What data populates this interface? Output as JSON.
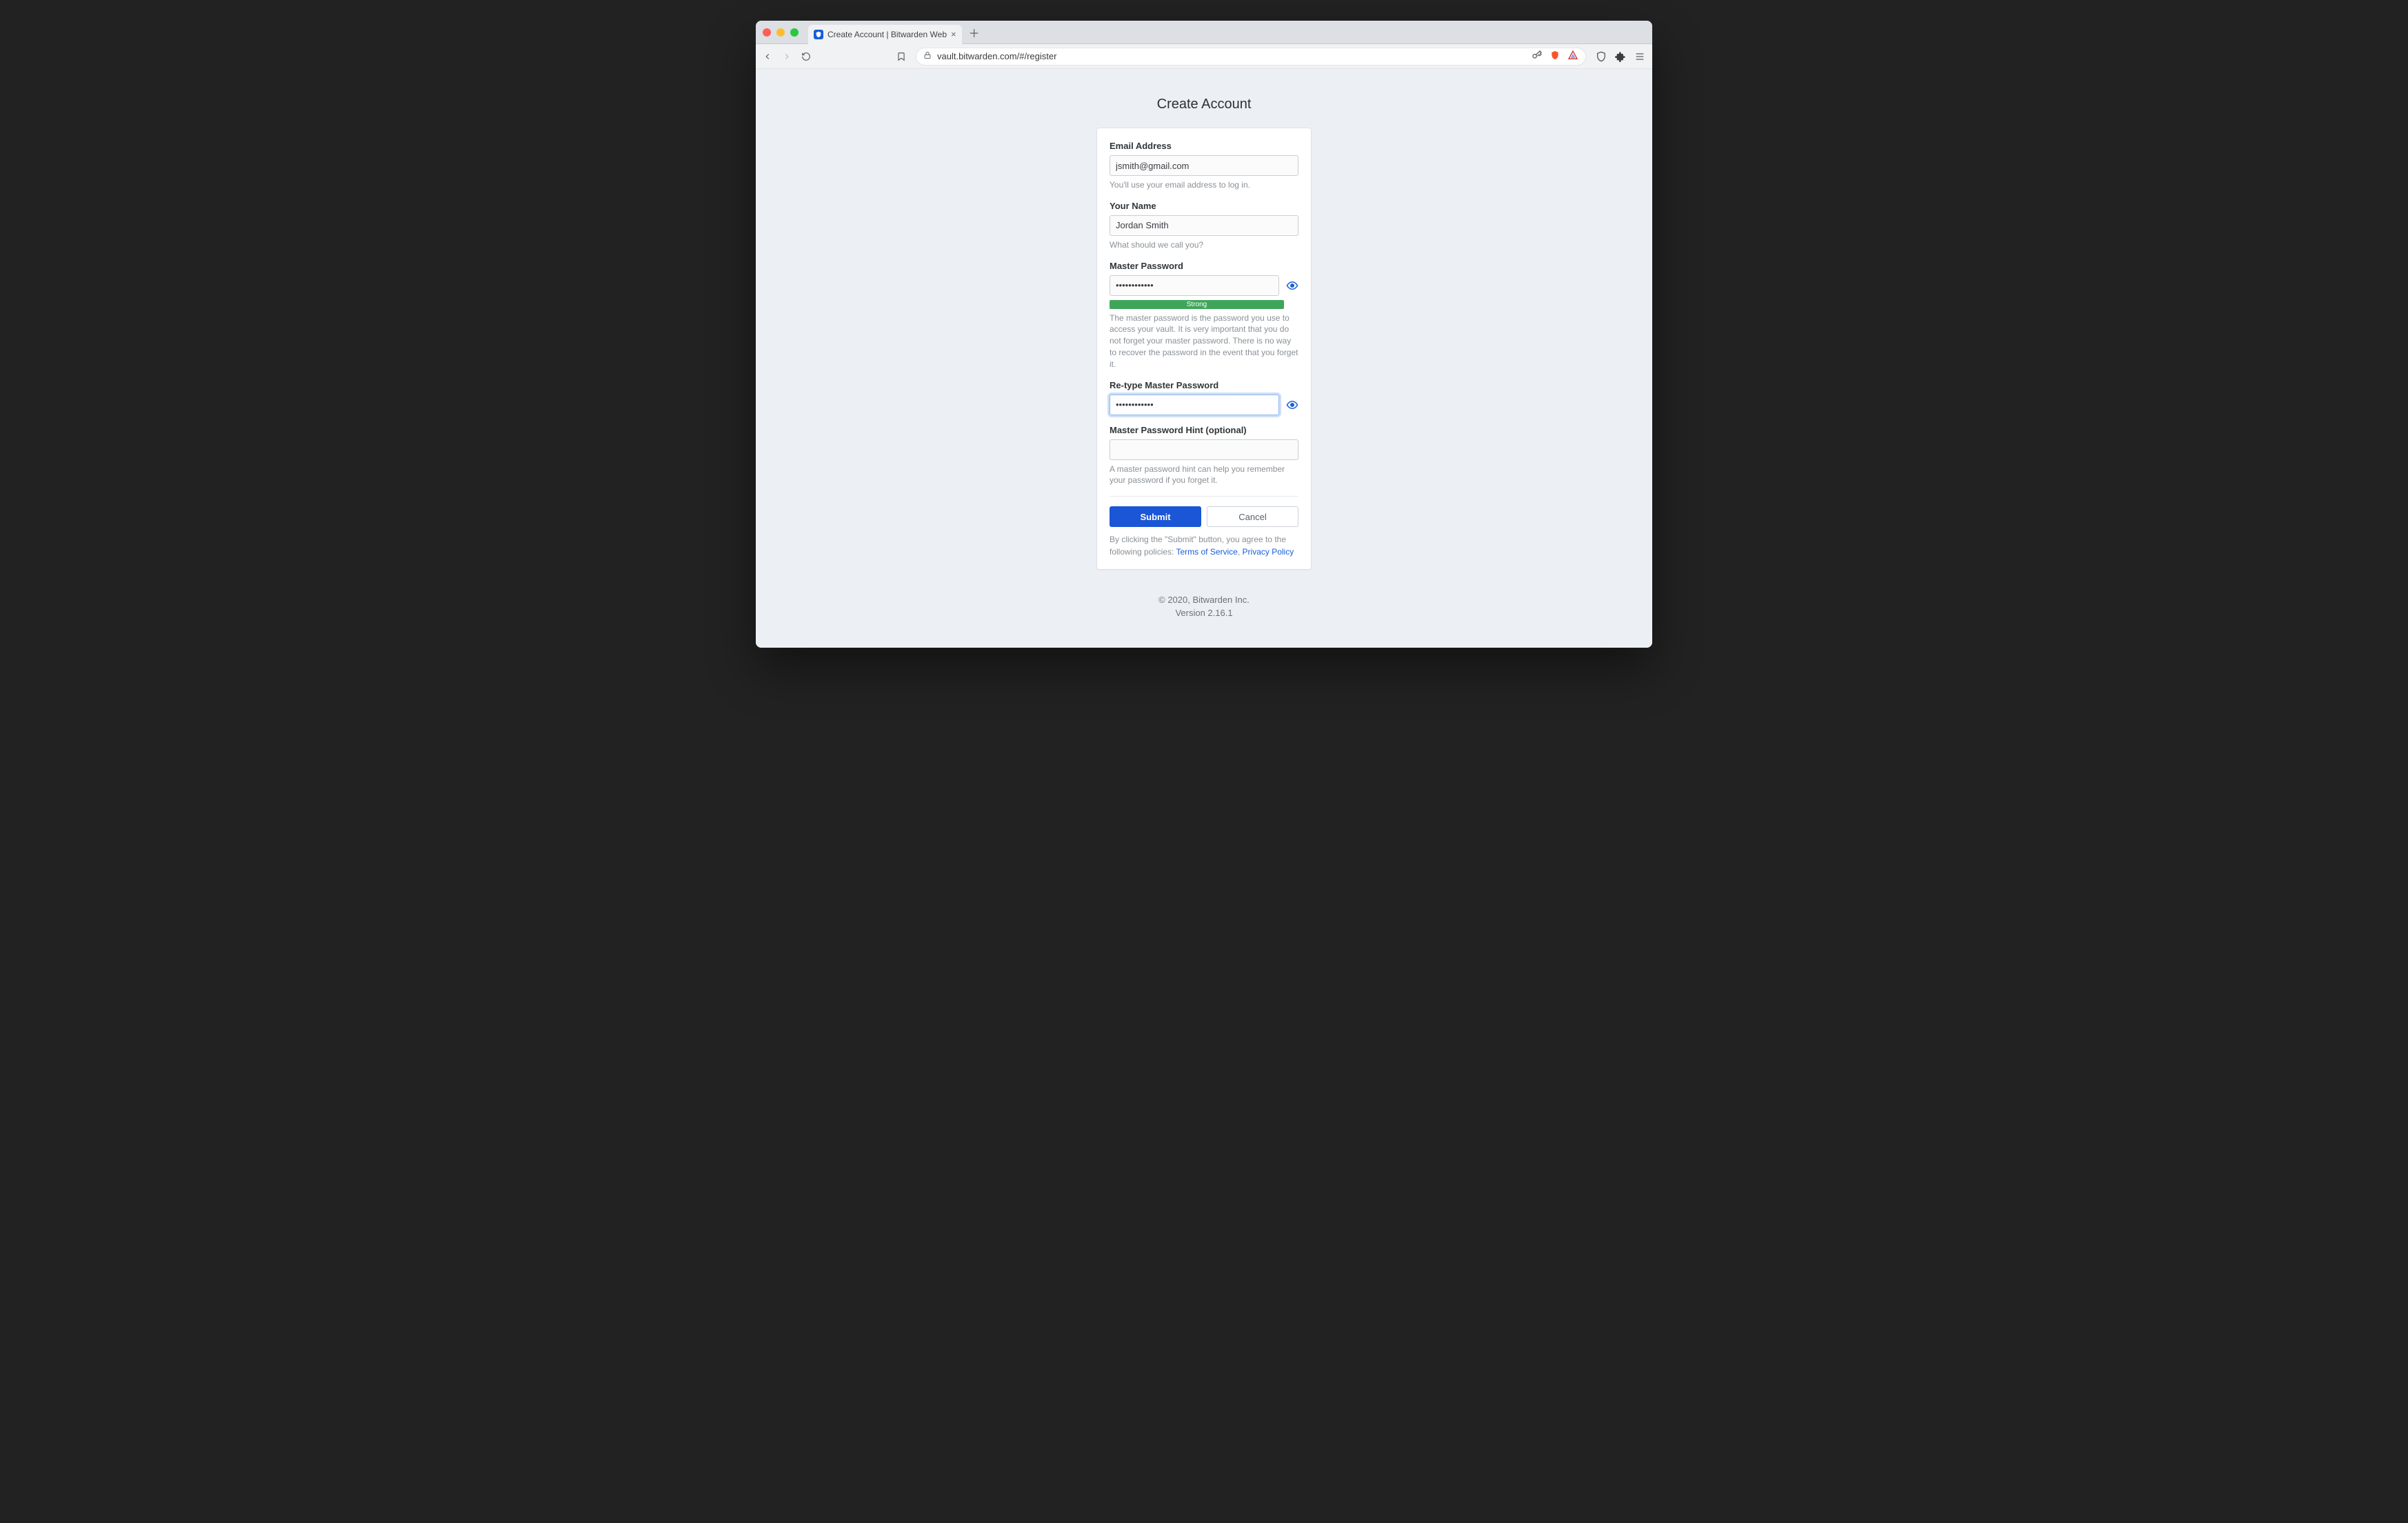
{
  "browser": {
    "tab_title": "Create Account | Bitwarden Web",
    "url": "vault.bitwarden.com/#/register"
  },
  "page": {
    "title": "Create Account"
  },
  "form": {
    "email": {
      "label": "Email Address",
      "value": "jsmith@gmail.com",
      "hint": "You'll use your email address to log in."
    },
    "name": {
      "label": "Your Name",
      "value": "Jordan Smith",
      "hint": "What should we call you?"
    },
    "master_password": {
      "label": "Master Password",
      "value": "••••••••••••",
      "strength": "Strong",
      "hint": "The master password is the password you use to access your vault. It is very important that you do not forget your master password. There is no way to recover the password in the event that you forget it."
    },
    "retype_password": {
      "label": "Re-type Master Password",
      "value": "••••••••••••"
    },
    "hint_field": {
      "label": "Master Password Hint (optional)",
      "value": "",
      "hint": "A master password hint can help you remember your password if you forget it."
    }
  },
  "buttons": {
    "submit": "Submit",
    "cancel": "Cancel"
  },
  "agreement": {
    "prefix": "By clicking the \"Submit\" button, you agree to the following policies: ",
    "tos": "Terms of Service",
    "sep": ", ",
    "privacy": "Privacy Policy"
  },
  "footer": {
    "copyright": "© 2020, Bitwarden Inc.",
    "version": "Version 2.16.1"
  }
}
